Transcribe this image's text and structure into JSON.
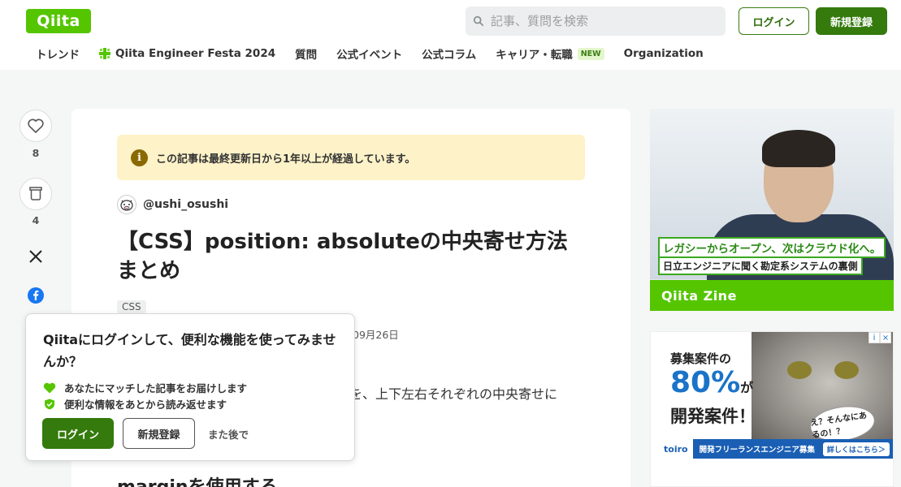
{
  "header": {
    "logo": "Qiita",
    "search_placeholder": "記事、質問を検索",
    "login": "ログイン",
    "signup": "新規登録"
  },
  "nav": {
    "items": [
      "トレンド",
      "Qiita Engineer Festa 2024",
      "質問",
      "公式イベント",
      "公式コラム",
      "キャリア・転職",
      "Organization"
    ],
    "new_badge": "NEW"
  },
  "rail": {
    "likes": "8",
    "stocks": "4"
  },
  "article": {
    "notice": "この記事は最終更新日から1年以上が経過しています。",
    "author": "@ushi_osushi",
    "title": "【CSS】position: absoluteの中央寄せ方法まとめ",
    "tag": "CSS",
    "date_fragment": "09月26日",
    "body_fragment": "を、上下左右それぞれの中央寄せに",
    "subheading_fragment": "marginを使用する"
  },
  "popup": {
    "title": "Qiitaにログインして、便利な機能を使ってみませんか？",
    "features": [
      "あなたにマッチした記事をお届けします",
      "便利な情報をあとから読み返せます"
    ],
    "login": "ログイン",
    "signup": "新規登録",
    "later": "また後で"
  },
  "ads": {
    "zine_caption1": "レガシーからオープン、次はクラウド化へ。",
    "zine_caption2": "日立エンジニアに聞く勘定系システムの裏側",
    "zine_brand": "Qiita Zine",
    "toiro_line1": "募集案件の",
    "toiro_big": "80%",
    "toiro_ga": "が",
    "toiro_line3": "開発案件！",
    "toiro_bubble": "え？そんなにあるの！？",
    "toiro_logo": "toiro",
    "toiro_bar": "開発フリーランスエンジニア募集",
    "toiro_cta": "詳しくはこちら＞"
  },
  "colors": {
    "brand_green": "#55c500",
    "button_green": "#347a0c",
    "notice_bg": "#fdf2c8"
  }
}
